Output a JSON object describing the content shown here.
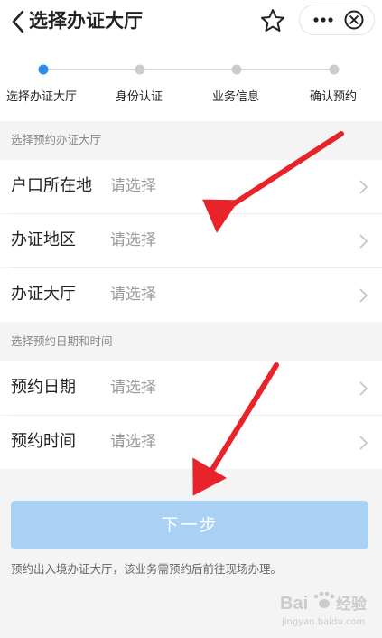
{
  "header": {
    "title": "选择办证大厅",
    "back_icon": "back-chevron-icon",
    "star_icon": "star-icon",
    "more_icon": "more-dots-icon",
    "close_icon": "close-circle-icon"
  },
  "steps": [
    {
      "label": "选择办证大厅",
      "active": true
    },
    {
      "label": "身份认证",
      "active": false
    },
    {
      "label": "业务信息",
      "active": false
    },
    {
      "label": "确认预约",
      "active": false
    }
  ],
  "colors": {
    "accent": "#2c8df0",
    "step_inactive": "#cccccc",
    "button_disabled": "#a9d1f4",
    "annotation_arrow": "#e8232a"
  },
  "section1": {
    "label": "选择预约办证大厅",
    "rows": [
      {
        "label": "户口所在地",
        "value": "请选择"
      },
      {
        "label": "办证地区",
        "value": "请选择"
      },
      {
        "label": "办证大厅",
        "value": "请选择"
      }
    ]
  },
  "section2": {
    "label": "选择预约日期和时间",
    "rows": [
      {
        "label": "预约日期",
        "value": "请选择"
      },
      {
        "label": "预约时间",
        "value": "请选择"
      }
    ]
  },
  "next_button": {
    "label": "下一步"
  },
  "note": "预约出入境办证大厅，该业务需预约后前往现场办理。",
  "watermark": {
    "text": "Baidu经验",
    "sub": "jingyan.baidu.com"
  }
}
